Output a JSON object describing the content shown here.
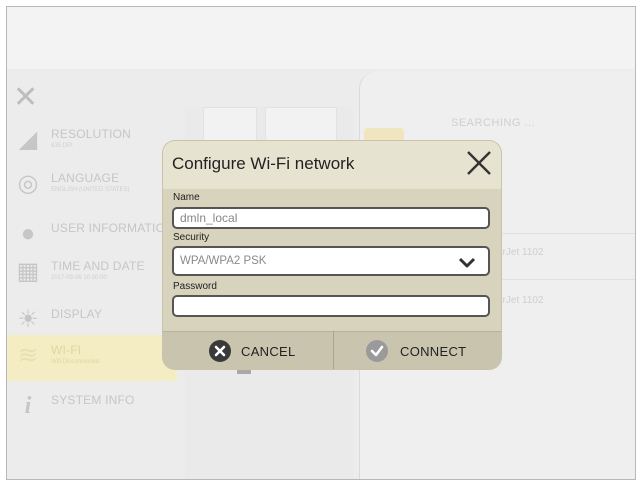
{
  "background": {
    "sidebar_items": [
      {
        "label": "RESOLUTION",
        "sub": "635 DPI",
        "icon": "ruler-icon"
      },
      {
        "label": "LANGUAGE",
        "sub": "ENGLISH (UNITED STATES)",
        "icon": "globe-icon"
      },
      {
        "label": "USER INFORMATION",
        "sub": "",
        "icon": "user-icon"
      },
      {
        "label": "TIME AND DATE",
        "sub": "2017-09-06 10:00:00",
        "icon": "calendar-clock-icon"
      },
      {
        "label": "DISPLAY",
        "sub": "",
        "icon": "brightness-icon"
      },
      {
        "label": "WI-FI",
        "sub": "Wifi Disconnected",
        "icon": "wifi-icon"
      },
      {
        "label": "SYSTEM INFO",
        "sub": "",
        "icon": "info-icon"
      }
    ],
    "searching": "SEARCHING ...",
    "printers": [
      "erJet 1102",
      "erJet 1102"
    ]
  },
  "dialog": {
    "title": "Configure Wi-Fi network",
    "name_label": "Name",
    "name_value": "dmln_local",
    "security_label": "Security",
    "security_value": "WPA/WPA2 PSK",
    "password_label": "Password",
    "password_value": "",
    "cancel_label": "CANCEL",
    "connect_label": "CONNECT"
  },
  "colors": {
    "dialog_bg": "#d8d3bd",
    "dialog_header": "#e7e3d1",
    "active_item": "#f4ecc3",
    "cancel_icon": "#3a3a3a",
    "connect_icon": "#9a9a9a"
  }
}
